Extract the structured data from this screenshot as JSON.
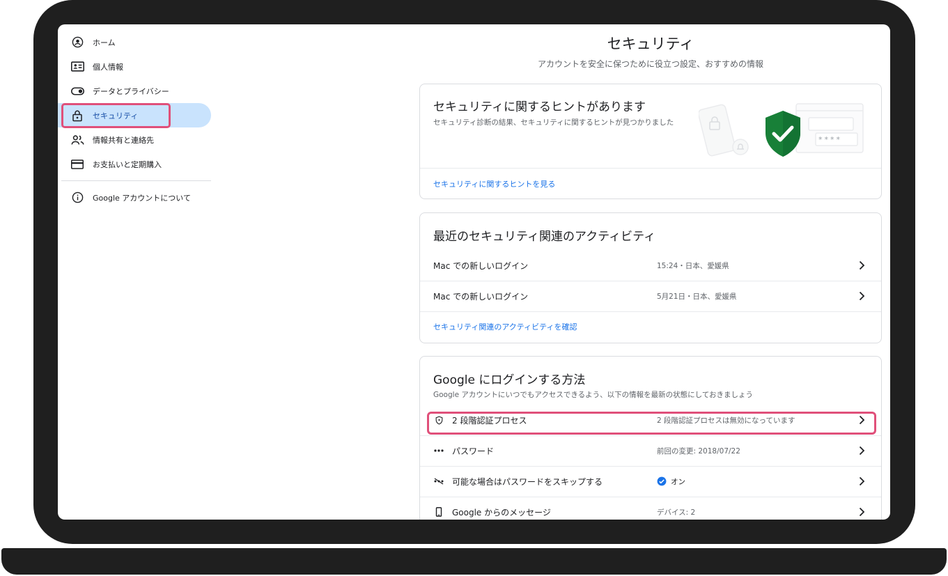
{
  "sidebar": {
    "items": [
      {
        "label": "ホーム",
        "icon": "account-circle-icon"
      },
      {
        "label": "個人情報",
        "icon": "id-card-icon"
      },
      {
        "label": "データとプライバシー",
        "icon": "toggle-icon"
      },
      {
        "label": "セキュリティ",
        "icon": "lock-icon"
      },
      {
        "label": "情報共有と連絡先",
        "icon": "people-icon"
      },
      {
        "label": "お支払いと定期購入",
        "icon": "credit-card-icon"
      }
    ],
    "about": {
      "label": "Google アカウントについて",
      "icon": "info-icon"
    }
  },
  "header": {
    "title": "セキュリティ",
    "subtitle": "アカウントを安全に保つために役立つ設定、おすすめの情報"
  },
  "tips_card": {
    "title": "セキュリティに関するヒントがあります",
    "desc": "セキュリティ診断の結果、セキュリティに関するヒントが見つかりました",
    "link": "セキュリティに関するヒントを見る",
    "illus_mask": "****"
  },
  "activity_card": {
    "title": "最近のセキュリティ関連のアクティビティ",
    "rows": [
      {
        "label": "Mac での新しいログイン",
        "value": "15:24・日本、愛媛県"
      },
      {
        "label": "Mac での新しいログイン",
        "value": "5月21日・日本、愛媛県"
      }
    ],
    "link": "セキュリティ関連のアクティビティを確認"
  },
  "signin_card": {
    "title": "Google にログインする方法",
    "desc": "Google アカウントにいつでもアクセスできるよう、以下の情報を最新の状態にしておきましょう",
    "rows": [
      {
        "label": "2 段階認証プロセス",
        "value": "2 段階認証プロセスは無効になっています",
        "icon": "shield-icon"
      },
      {
        "label": "パスワード",
        "value": "前回の変更: 2018/07/22",
        "icon": "password-dots-icon"
      },
      {
        "label": "可能な場合はパスワードをスキップする",
        "value": "オン",
        "icon": "password-skip-icon"
      },
      {
        "label": "Google からのメッセージ",
        "value": "デバイス: 2",
        "icon": "phone-icon"
      }
    ]
  },
  "colors": {
    "accent": "#1a73e8",
    "active_nav": "#c9e3fd",
    "highlight": "#e0507a",
    "shield": "#188038"
  }
}
